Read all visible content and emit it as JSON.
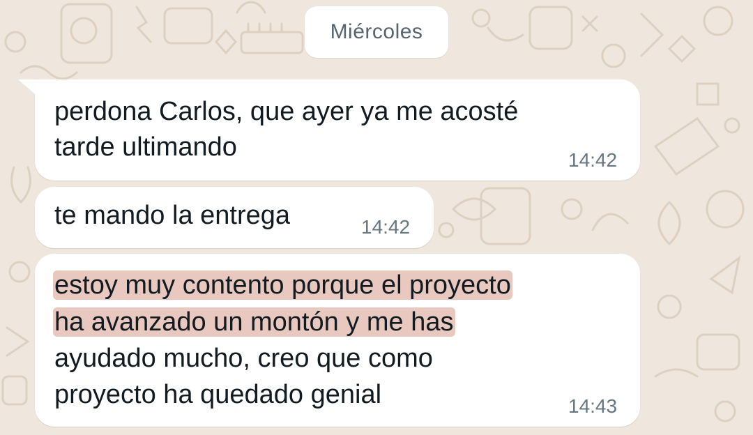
{
  "date_separator": "Miércoles",
  "messages": [
    {
      "lines": [
        "perdona Carlos, que ayer ya me acosté",
        "tarde ultimando"
      ],
      "time": "14:42"
    },
    {
      "lines": [
        "te mando la entrega"
      ],
      "time": "14:42"
    },
    {
      "lines": [
        "estoy muy contento porque el proyecto",
        "ha avanzado un montón y me has",
        "ayudado mucho, creo que como",
        "proyecto ha quedado genial"
      ],
      "highlighted_lines": [
        0,
        1
      ],
      "time": "14:43"
    }
  ],
  "colors": {
    "wallpaper": "#efe7dd",
    "bubble": "#ffffff",
    "highlight": "#e9c9bf",
    "text": "#111b21",
    "timestamp": "#667781"
  }
}
